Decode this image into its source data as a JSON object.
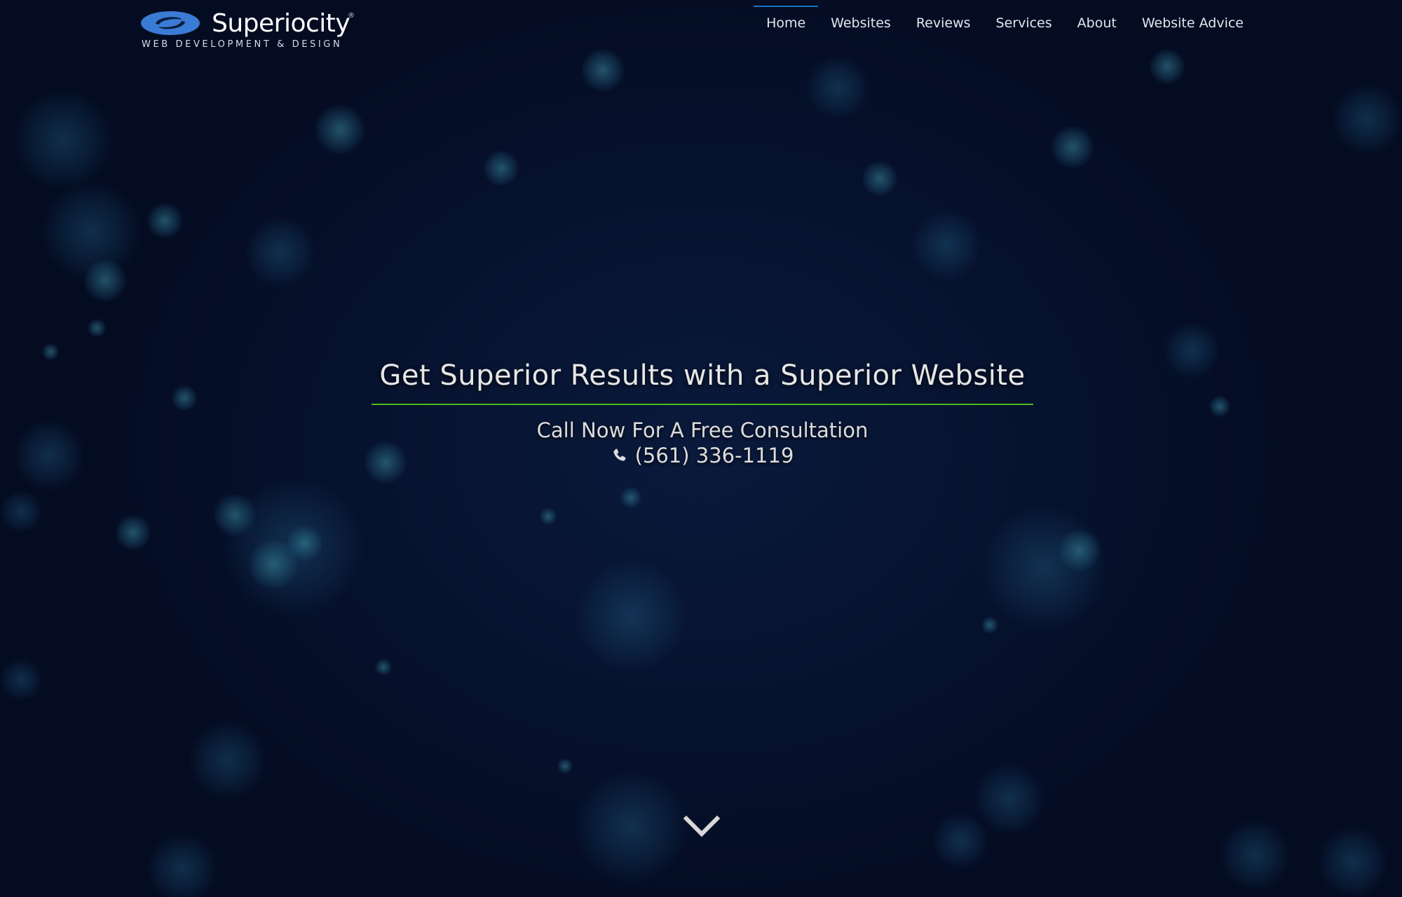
{
  "brand": {
    "name": "Superiocity",
    "registered_mark": "®",
    "tagline": "WEB DEVELOPMENT & DESIGN",
    "logo_color": "#3a7bd5"
  },
  "nav": {
    "items": [
      {
        "label": "Home",
        "active": true
      },
      {
        "label": "Websites",
        "active": false
      },
      {
        "label": "Reviews",
        "active": false
      },
      {
        "label": "Services",
        "active": false
      },
      {
        "label": "About",
        "active": false
      },
      {
        "label": "Website Advice",
        "active": false
      }
    ],
    "active_indicator_color": "#1e73be"
  },
  "hero": {
    "title": "Get Superior Results with a Superior Website",
    "divider_color": "#4cbb17",
    "subtitle": "Call Now For A Free Consultation",
    "phone": "(561) 336-1119",
    "phone_icon": "phone-icon"
  },
  "scroll": {
    "icon": "chevron-down-icon"
  },
  "colors": {
    "background": "#06102a",
    "text": "#e6e6e6"
  }
}
